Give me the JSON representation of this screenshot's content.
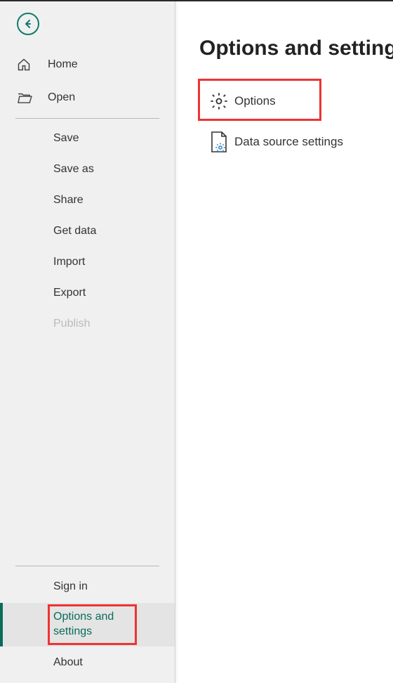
{
  "sidebar": {
    "top": [
      {
        "label": "Home",
        "icon": "home-icon"
      },
      {
        "label": "Open",
        "icon": "folder-open-icon"
      }
    ],
    "fileOps": [
      {
        "label": "Save"
      },
      {
        "label": "Save as"
      },
      {
        "label": "Share"
      },
      {
        "label": "Get data"
      },
      {
        "label": "Import"
      },
      {
        "label": "Export"
      },
      {
        "label": "Publish",
        "disabled": true
      }
    ],
    "bottom": [
      {
        "label": "Sign in"
      },
      {
        "label": "Options and settings",
        "active": true
      },
      {
        "label": "About"
      }
    ]
  },
  "main": {
    "title": "Options and settings",
    "items": [
      {
        "label": "Options"
      },
      {
        "label": "Data source settings"
      }
    ]
  }
}
